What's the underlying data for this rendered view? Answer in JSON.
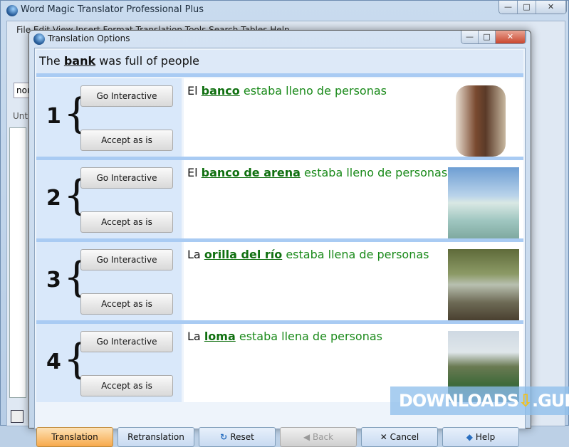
{
  "main_window": {
    "title": "Word Magic Translator Professional Plus",
    "menu": "File  Edit  View  Insert  Format  Translation  Tools  Search  Tables  Help",
    "combo": "nor",
    "tab": "Unt"
  },
  "dialog": {
    "title": "Translation Options",
    "source": {
      "before": "The ",
      "key": "bank",
      "after": " was full of people"
    },
    "options": [
      {
        "num": "1",
        "lead": "El ",
        "key": "banco",
        "rest": " estaba lleno de personas",
        "go": "Go Interactive",
        "accept": "Accept as is",
        "image": "bank-teller-photo"
      },
      {
        "num": "2",
        "lead": "El ",
        "key": "banco de arena",
        "rest": " estaba lleno de personas",
        "go": "Go Interactive",
        "accept": "Accept as is",
        "image": "sandbank-photo"
      },
      {
        "num": "3",
        "lead": "La ",
        "key": "orilla del río",
        "rest": " estaba llena de personas",
        "go": "Go Interactive",
        "accept": "Accept as is",
        "image": "riverbank-photo"
      },
      {
        "num": "4",
        "lead": "La ",
        "key": "loma",
        "rest": " estaba llena de personas",
        "go": "Go Interactive",
        "accept": "Accept as is",
        "image": "hill-photo"
      }
    ],
    "footer": {
      "translation": "Translation",
      "retranslation": "Retranslation",
      "reset": "Reset",
      "back": "Back",
      "cancel": "Cancel",
      "help": "Help"
    }
  },
  "watermark": "DOWNLOADS",
  "watermark2": ".GURU"
}
